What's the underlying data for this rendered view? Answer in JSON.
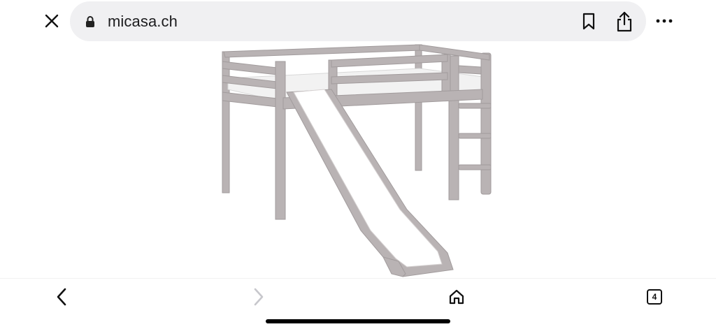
{
  "browser": {
    "url": "micasa.ch",
    "close_icon": "close-icon",
    "lock_icon": "lock-icon",
    "bookmark_icon": "bookmark-icon",
    "share_icon": "share-icon",
    "more_icon": "more-icon"
  },
  "toolbar": {
    "back_icon": "chevron-left-icon",
    "forward_icon": "chevron-right-icon",
    "forward_enabled": false,
    "home_icon": "home-icon",
    "tabs_count": "4"
  },
  "content": {
    "image": "loft-bed-with-slide",
    "bed_color": "#b9b3b4",
    "slide_color": "#ffffff"
  }
}
